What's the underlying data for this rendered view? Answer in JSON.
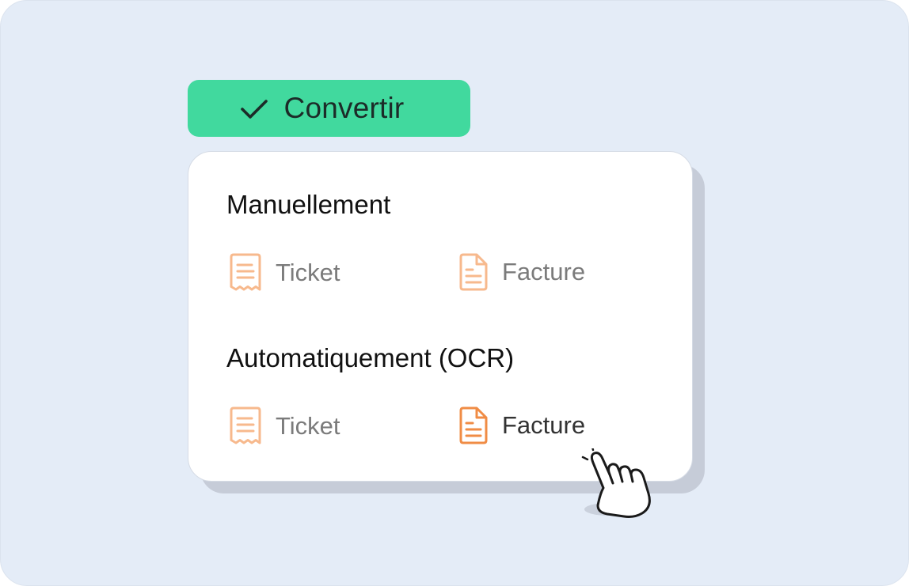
{
  "convert_button": {
    "label": "Convertir",
    "icon": "check-icon",
    "color": "#41d99e"
  },
  "menu": {
    "sections": [
      {
        "title": "Manuellement",
        "options": [
          {
            "label": "Ticket",
            "icon": "receipt-icon"
          },
          {
            "label": "Facture",
            "icon": "invoice-icon"
          }
        ]
      },
      {
        "title": "Automatiquement (OCR)",
        "options": [
          {
            "label": "Ticket",
            "icon": "receipt-icon"
          },
          {
            "label": "Facture",
            "icon": "invoice-icon",
            "state": "hovered"
          }
        ]
      }
    ]
  },
  "colors": {
    "background": "#e4ecf7",
    "icon_light": "#f7b98d",
    "icon_active": "#f08c45"
  },
  "pointer": "hand-pointer-icon"
}
